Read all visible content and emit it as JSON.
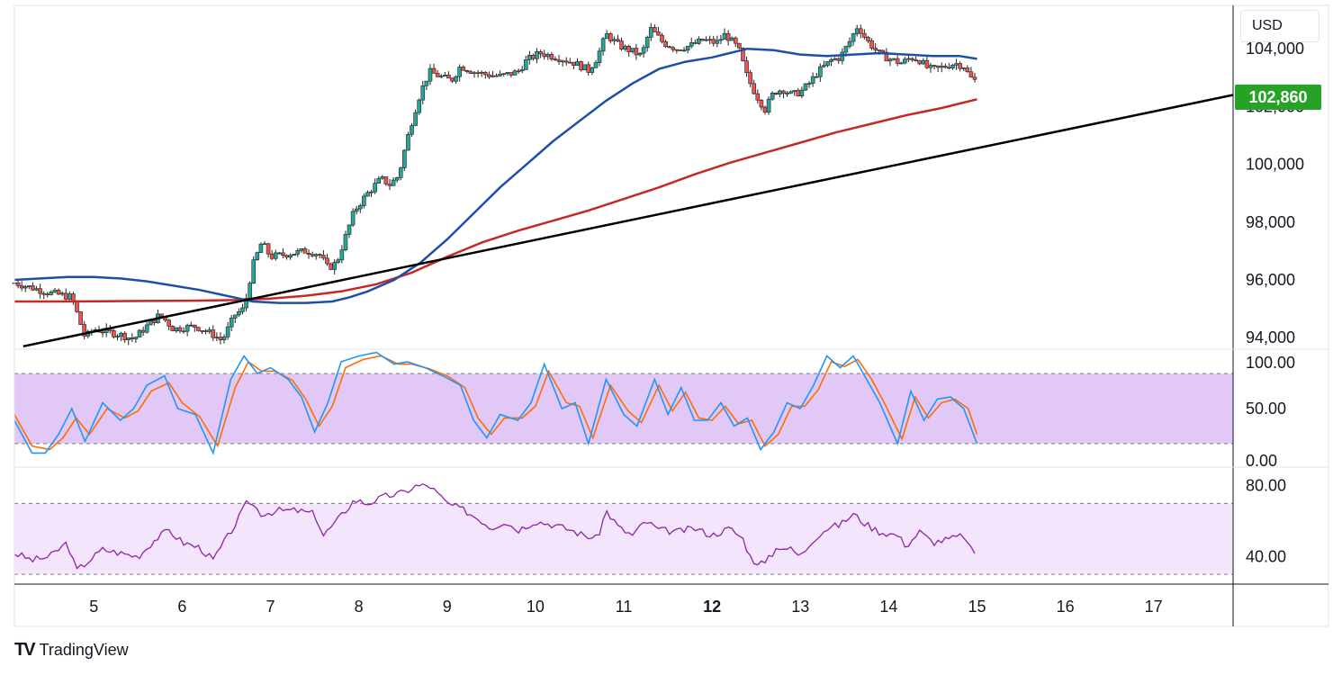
{
  "currency": "USD",
  "last_price_label": "102,860",
  "brand": {
    "logo": "TV",
    "name": "TradingView"
  },
  "colors": {
    "bull": "#26a69a",
    "bear": "#ef5350",
    "ma_fast": "#1e4fa8",
    "ma_slow": "#c62828",
    "trendline": "#000000",
    "stoch_k": "#2196f3",
    "stoch_d": "#ff6d00",
    "stoch_band": "#e1c8f7",
    "rsi_line": "#8e24aa",
    "rsi_band": "#f3e5fb",
    "price_tag": "#26a227"
  },
  "chart_data": {
    "type": "candlestick",
    "price_axis": {
      "ylim": [
        93600,
        105500
      ],
      "ticks": [
        94000,
        96000,
        98000,
        100000,
        102000,
        104000
      ],
      "tick_labels": [
        "94,000",
        "96,000",
        "98,000",
        "100,000",
        "102,000",
        "104,000"
      ]
    },
    "x_axis": {
      "day_range": [
        4.1,
        17.9
      ],
      "days": [
        5,
        6,
        7,
        8,
        9,
        10,
        11,
        12,
        13,
        14,
        15,
        16,
        17
      ],
      "labels": [
        "5",
        "6",
        "7",
        "8",
        "9",
        "10",
        "11",
        "12",
        "13",
        "14",
        "15",
        "16",
        "17"
      ],
      "bold_label": "12"
    },
    "last_price": 102860,
    "close_path": [
      [
        4.1,
        95900
      ],
      [
        4.5,
        95550
      ],
      [
        4.75,
        95400
      ],
      [
        4.9,
        94000
      ],
      [
        5.0,
        94300
      ],
      [
        5.3,
        94100
      ],
      [
        5.45,
        93950
      ],
      [
        5.6,
        94400
      ],
      [
        5.75,
        94800
      ],
      [
        5.9,
        94300
      ],
      [
        6.15,
        94400
      ],
      [
        6.35,
        94100
      ],
      [
        6.45,
        93900
      ],
      [
        6.6,
        94800
      ],
      [
        6.7,
        95000
      ],
      [
        6.8,
        96500
      ],
      [
        6.9,
        97300
      ],
      [
        7.0,
        96800
      ],
      [
        7.2,
        96900
      ],
      [
        7.4,
        97000
      ],
      [
        7.55,
        96900
      ],
      [
        7.65,
        96400
      ],
      [
        7.75,
        96600
      ],
      [
        7.85,
        97500
      ],
      [
        7.95,
        98400
      ],
      [
        8.1,
        99000
      ],
      [
        8.25,
        99500
      ],
      [
        8.35,
        99300
      ],
      [
        8.45,
        99600
      ],
      [
        8.55,
        100900
      ],
      [
        8.62,
        101700
      ],
      [
        8.7,
        102500
      ],
      [
        8.8,
        103200
      ],
      [
        8.95,
        103000
      ],
      [
        9.05,
        102900
      ],
      [
        9.15,
        103400
      ],
      [
        9.3,
        103200
      ],
      [
        9.45,
        103100
      ],
      [
        9.6,
        103050
      ],
      [
        9.8,
        103200
      ],
      [
        9.9,
        103600
      ],
      [
        10.05,
        103850
      ],
      [
        10.25,
        103700
      ],
      [
        10.45,
        103500
      ],
      [
        10.6,
        103250
      ],
      [
        10.7,
        103700
      ],
      [
        10.8,
        104500
      ],
      [
        10.95,
        104100
      ],
      [
        11.1,
        103900
      ],
      [
        11.2,
        103750
      ],
      [
        11.3,
        104700
      ],
      [
        11.45,
        104200
      ],
      [
        11.6,
        104000
      ],
      [
        11.75,
        104100
      ],
      [
        11.9,
        104300
      ],
      [
        12.05,
        104200
      ],
      [
        12.15,
        104500
      ],
      [
        12.3,
        104000
      ],
      [
        12.4,
        103000
      ],
      [
        12.5,
        102400
      ],
      [
        12.6,
        101900
      ],
      [
        12.7,
        102500
      ],
      [
        12.8,
        102600
      ],
      [
        12.9,
        102400
      ],
      [
        13.0,
        102500
      ],
      [
        13.1,
        102800
      ],
      [
        13.2,
        103200
      ],
      [
        13.35,
        103600
      ],
      [
        13.45,
        103700
      ],
      [
        13.55,
        104200
      ],
      [
        13.65,
        104800
      ],
      [
        13.75,
        104300
      ],
      [
        13.9,
        103800
      ],
      [
        14.05,
        103600
      ],
      [
        14.15,
        103500
      ],
      [
        14.25,
        103700
      ],
      [
        14.35,
        103600
      ],
      [
        14.45,
        103300
      ],
      [
        14.55,
        103300
      ],
      [
        14.65,
        103400
      ],
      [
        14.75,
        103500
      ],
      [
        14.85,
        103400
      ],
      [
        14.92,
        103000
      ],
      [
        15.0,
        102860
      ]
    ],
    "ma_fast_path": [
      [
        4.1,
        96000
      ],
      [
        4.4,
        96050
      ],
      [
        4.7,
        96100
      ],
      [
        5.0,
        96100
      ],
      [
        5.3,
        96050
      ],
      [
        5.6,
        95950
      ],
      [
        5.9,
        95800
      ],
      [
        6.2,
        95650
      ],
      [
        6.5,
        95450
      ],
      [
        6.8,
        95250
      ],
      [
        7.1,
        95200
      ],
      [
        7.4,
        95200
      ],
      [
        7.7,
        95250
      ],
      [
        7.9,
        95400
      ],
      [
        8.1,
        95600
      ],
      [
        8.4,
        96000
      ],
      [
        8.7,
        96600
      ],
      [
        9.0,
        97400
      ],
      [
        9.3,
        98300
      ],
      [
        9.6,
        99200
      ],
      [
        9.9,
        100000
      ],
      [
        10.2,
        100800
      ],
      [
        10.5,
        101500
      ],
      [
        10.8,
        102200
      ],
      [
        11.1,
        102800
      ],
      [
        11.4,
        103300
      ],
      [
        11.7,
        103550
      ],
      [
        12.0,
        103700
      ],
      [
        12.2,
        103850
      ],
      [
        12.4,
        104000
      ],
      [
        12.7,
        103950
      ],
      [
        13.0,
        103800
      ],
      [
        13.3,
        103750
      ],
      [
        13.6,
        103800
      ],
      [
        13.9,
        103850
      ],
      [
        14.2,
        103800
      ],
      [
        14.5,
        103750
      ],
      [
        14.8,
        103750
      ],
      [
        15.0,
        103650
      ]
    ],
    "ma_slow_path": [
      [
        4.1,
        95250
      ],
      [
        4.6,
        95250
      ],
      [
        5.1,
        95260
      ],
      [
        5.6,
        95270
      ],
      [
        6.1,
        95280
      ],
      [
        6.6,
        95300
      ],
      [
        7.0,
        95350
      ],
      [
        7.4,
        95450
      ],
      [
        7.8,
        95600
      ],
      [
        8.2,
        95850
      ],
      [
        8.6,
        96250
      ],
      [
        9.0,
        96800
      ],
      [
        9.4,
        97300
      ],
      [
        9.8,
        97700
      ],
      [
        10.2,
        98050
      ],
      [
        10.6,
        98400
      ],
      [
        11.0,
        98800
      ],
      [
        11.4,
        99200
      ],
      [
        11.8,
        99650
      ],
      [
        12.2,
        100050
      ],
      [
        12.6,
        100400
      ],
      [
        13.0,
        100750
      ],
      [
        13.4,
        101100
      ],
      [
        13.8,
        101400
      ],
      [
        14.2,
        101700
      ],
      [
        14.6,
        101950
      ],
      [
        15.0,
        102250
      ]
    ],
    "trendline": {
      "start": [
        4.2,
        93700
      ],
      "end": [
        17.9,
        102400
      ]
    },
    "stochastic": {
      "ylim": [
        0,
        100
      ],
      "ticks": [
        0,
        50,
        100
      ],
      "tick_labels": [
        "0.00",
        "50.00",
        "100.00"
      ],
      "band": [
        20,
        80
      ],
      "k_path": [
        [
          4.1,
          40
        ],
        [
          4.3,
          12
        ],
        [
          4.45,
          12
        ],
        [
          4.6,
          28
        ],
        [
          4.75,
          50
        ],
        [
          4.9,
          22
        ],
        [
          5.1,
          55
        ],
        [
          5.3,
          40
        ],
        [
          5.45,
          50
        ],
        [
          5.6,
          70
        ],
        [
          5.8,
          78
        ],
        [
          5.95,
          50
        ],
        [
          6.15,
          45
        ],
        [
          6.35,
          12
        ],
        [
          6.55,
          75
        ],
        [
          6.7,
          95
        ],
        [
          6.85,
          80
        ],
        [
          7.0,
          85
        ],
        [
          7.2,
          75
        ],
        [
          7.35,
          60
        ],
        [
          7.5,
          30
        ],
        [
          7.65,
          55
        ],
        [
          7.8,
          90
        ],
        [
          8.0,
          95
        ],
        [
          8.2,
          98
        ],
        [
          8.4,
          88
        ],
        [
          8.55,
          90
        ],
        [
          8.75,
          85
        ],
        [
          8.95,
          78
        ],
        [
          9.15,
          70
        ],
        [
          9.3,
          40
        ],
        [
          9.45,
          25
        ],
        [
          9.6,
          45
        ],
        [
          9.8,
          40
        ],
        [
          9.95,
          55
        ],
        [
          10.1,
          88
        ],
        [
          10.3,
          50
        ],
        [
          10.45,
          55
        ],
        [
          10.6,
          20
        ],
        [
          10.8,
          75
        ],
        [
          11.0,
          45
        ],
        [
          11.15,
          35
        ],
        [
          11.35,
          75
        ],
        [
          11.5,
          45
        ],
        [
          11.65,
          68
        ],
        [
          11.8,
          40
        ],
        [
          11.95,
          40
        ],
        [
          12.1,
          55
        ],
        [
          12.25,
          35
        ],
        [
          12.4,
          42
        ],
        [
          12.55,
          15
        ],
        [
          12.7,
          30
        ],
        [
          12.85,
          55
        ],
        [
          13.0,
          50
        ],
        [
          13.15,
          70
        ],
        [
          13.3,
          95
        ],
        [
          13.45,
          85
        ],
        [
          13.6,
          95
        ],
        [
          13.75,
          75
        ],
        [
          13.9,
          55
        ],
        [
          14.1,
          20
        ],
        [
          14.25,
          65
        ],
        [
          14.4,
          40
        ],
        [
          14.55,
          58
        ],
        [
          14.7,
          60
        ],
        [
          14.85,
          50
        ],
        [
          15.0,
          20
        ]
      ],
      "d_path": [
        [
          4.1,
          45
        ],
        [
          4.3,
          18
        ],
        [
          4.5,
          15
        ],
        [
          4.65,
          25
        ],
        [
          4.8,
          42
        ],
        [
          4.95,
          28
        ],
        [
          5.15,
          50
        ],
        [
          5.35,
          42
        ],
        [
          5.5,
          48
        ],
        [
          5.65,
          65
        ],
        [
          5.85,
          72
        ],
        [
          6.0,
          55
        ],
        [
          6.2,
          43
        ],
        [
          6.4,
          18
        ],
        [
          6.6,
          68
        ],
        [
          6.75,
          90
        ],
        [
          6.9,
          82
        ],
        [
          7.05,
          82
        ],
        [
          7.25,
          74
        ],
        [
          7.4,
          58
        ],
        [
          7.55,
          35
        ],
        [
          7.7,
          52
        ],
        [
          7.85,
          85
        ],
        [
          8.05,
          92
        ],
        [
          8.25,
          95
        ],
        [
          8.45,
          88
        ],
        [
          8.6,
          88
        ],
        [
          8.8,
          84
        ],
        [
          9.0,
          78
        ],
        [
          9.2,
          68
        ],
        [
          9.35,
          42
        ],
        [
          9.5,
          28
        ],
        [
          9.65,
          42
        ],
        [
          9.85,
          42
        ],
        [
          10.0,
          52
        ],
        [
          10.15,
          82
        ],
        [
          10.35,
          55
        ],
        [
          10.5,
          52
        ],
        [
          10.65,
          25
        ],
        [
          10.85,
          70
        ],
        [
          11.05,
          48
        ],
        [
          11.2,
          38
        ],
        [
          11.4,
          70
        ],
        [
          11.55,
          48
        ],
        [
          11.7,
          64
        ],
        [
          11.85,
          42
        ],
        [
          12.0,
          40
        ],
        [
          12.15,
          52
        ],
        [
          12.3,
          37
        ],
        [
          12.45,
          40
        ],
        [
          12.6,
          18
        ],
        [
          12.75,
          28
        ],
        [
          12.9,
          52
        ],
        [
          13.05,
          52
        ],
        [
          13.2,
          66
        ],
        [
          13.35,
          90
        ],
        [
          13.5,
          86
        ],
        [
          13.65,
          92
        ],
        [
          13.8,
          76
        ],
        [
          13.95,
          55
        ],
        [
          14.15,
          24
        ],
        [
          14.3,
          60
        ],
        [
          14.45,
          42
        ],
        [
          14.6,
          55
        ],
        [
          14.75,
          58
        ],
        [
          14.9,
          50
        ],
        [
          15.0,
          28
        ]
      ]
    },
    "rsi": {
      "ylim": [
        25,
        90
      ],
      "ticks": [
        40,
        80
      ],
      "tick_labels": [
        "40.00",
        "80.00"
      ],
      "band": [
        30,
        70
      ],
      "path": [
        [
          4.1,
          42
        ],
        [
          4.3,
          38
        ],
        [
          4.5,
          40
        ],
        [
          4.7,
          48
        ],
        [
          4.8,
          32
        ],
        [
          5.0,
          40
        ],
        [
          5.1,
          44
        ],
        [
          5.3,
          42
        ],
        [
          5.5,
          40
        ],
        [
          5.7,
          50
        ],
        [
          5.85,
          55
        ],
        [
          6.0,
          48
        ],
        [
          6.2,
          45
        ],
        [
          6.35,
          38
        ],
        [
          6.5,
          50
        ],
        [
          6.6,
          58
        ],
        [
          6.75,
          72
        ],
        [
          6.9,
          64
        ],
        [
          7.1,
          66
        ],
        [
          7.3,
          66
        ],
        [
          7.5,
          64
        ],
        [
          7.6,
          52
        ],
        [
          7.75,
          60
        ],
        [
          7.95,
          72
        ],
        [
          8.1,
          70
        ],
        [
          8.3,
          74
        ],
        [
          8.5,
          76
        ],
        [
          8.65,
          80
        ],
        [
          8.8,
          80
        ],
        [
          9.0,
          70
        ],
        [
          9.2,
          66
        ],
        [
          9.4,
          60
        ],
        [
          9.5,
          56
        ],
        [
          9.65,
          60
        ],
        [
          9.8,
          55
        ],
        [
          10.0,
          60
        ],
        [
          10.2,
          58
        ],
        [
          10.4,
          55
        ],
        [
          10.55,
          52
        ],
        [
          10.7,
          50
        ],
        [
          10.8,
          66
        ],
        [
          10.95,
          56
        ],
        [
          11.1,
          52
        ],
        [
          11.25,
          60
        ],
        [
          11.4,
          55
        ],
        [
          11.6,
          54
        ],
        [
          11.8,
          56
        ],
        [
          12.0,
          52
        ],
        [
          12.2,
          56
        ],
        [
          12.35,
          50
        ],
        [
          12.45,
          38
        ],
        [
          12.6,
          36
        ],
        [
          12.75,
          46
        ],
        [
          12.9,
          44
        ],
        [
          13.0,
          40
        ],
        [
          13.15,
          50
        ],
        [
          13.3,
          56
        ],
        [
          13.45,
          58
        ],
        [
          13.6,
          64
        ],
        [
          13.75,
          58
        ],
        [
          13.9,
          54
        ],
        [
          14.1,
          52
        ],
        [
          14.2,
          46
        ],
        [
          14.35,
          54
        ],
        [
          14.5,
          48
        ],
        [
          14.7,
          50
        ],
        [
          14.85,
          52
        ],
        [
          14.92,
          44
        ],
        [
          15.0,
          42
        ]
      ]
    }
  }
}
